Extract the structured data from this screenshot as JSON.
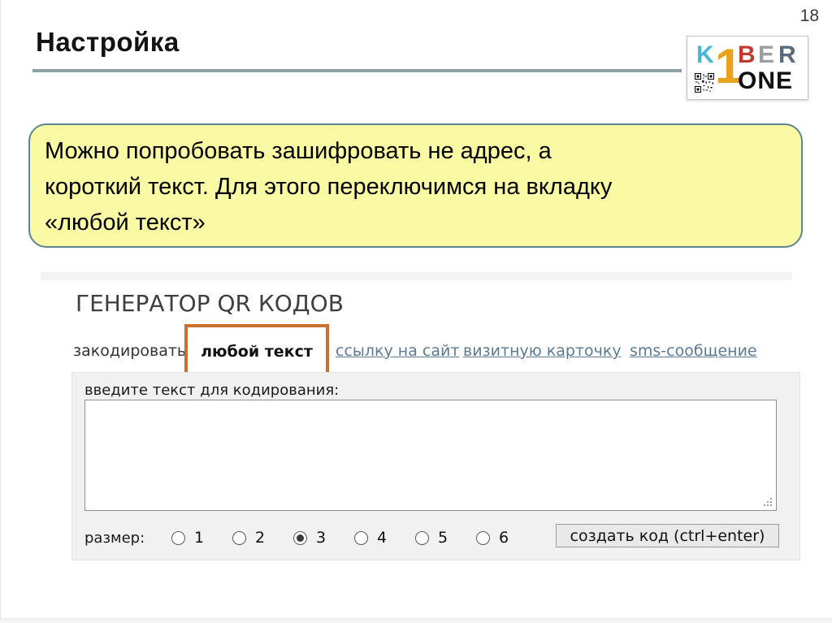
{
  "slide": {
    "page_number": "18",
    "title": "Настройка",
    "underline_color": "#8ba1a3"
  },
  "logo": {
    "letters": {
      "k": "K",
      "digit": "1",
      "b": "B",
      "e": "E",
      "r": "R",
      "one": "ONE"
    },
    "colors": {
      "k": "#45b6d6",
      "digit": "#e8a31e",
      "b": "#c13a2e",
      "e": "#9e9e9e",
      "r": "#5a6b7c",
      "one": "#111111"
    },
    "icons": {
      "qr": "qr-code-icon"
    }
  },
  "callout": {
    "lines": [
      "Можно попробовать зашифровать не адрес, а",
      "короткий текст. Для этого переключимся на вкладку",
      "«любой текст»"
    ],
    "bg_color": "#fafaa5",
    "border_color": "#5d8493"
  },
  "generator": {
    "heading": "ГЕНЕРАТОР QR КОДОВ",
    "tab_prefix": "закодировать",
    "active_tab": "любой текст",
    "links": [
      "ссылку на сайт",
      "визитную карточку",
      "sms-сообщение"
    ],
    "link_color": "#5b7a94",
    "highlight_color": "#c8702f",
    "form": {
      "textarea_label": "введите текст для кодирования:",
      "textarea_value": "",
      "size_label": "размер:",
      "size_options": [
        "1",
        "2",
        "3",
        "4",
        "5",
        "6"
      ],
      "size_selected": "3",
      "submit_label": "создать код (ctrl+enter)"
    },
    "icons": {
      "resize_grip": "resize-grip-icon"
    }
  }
}
